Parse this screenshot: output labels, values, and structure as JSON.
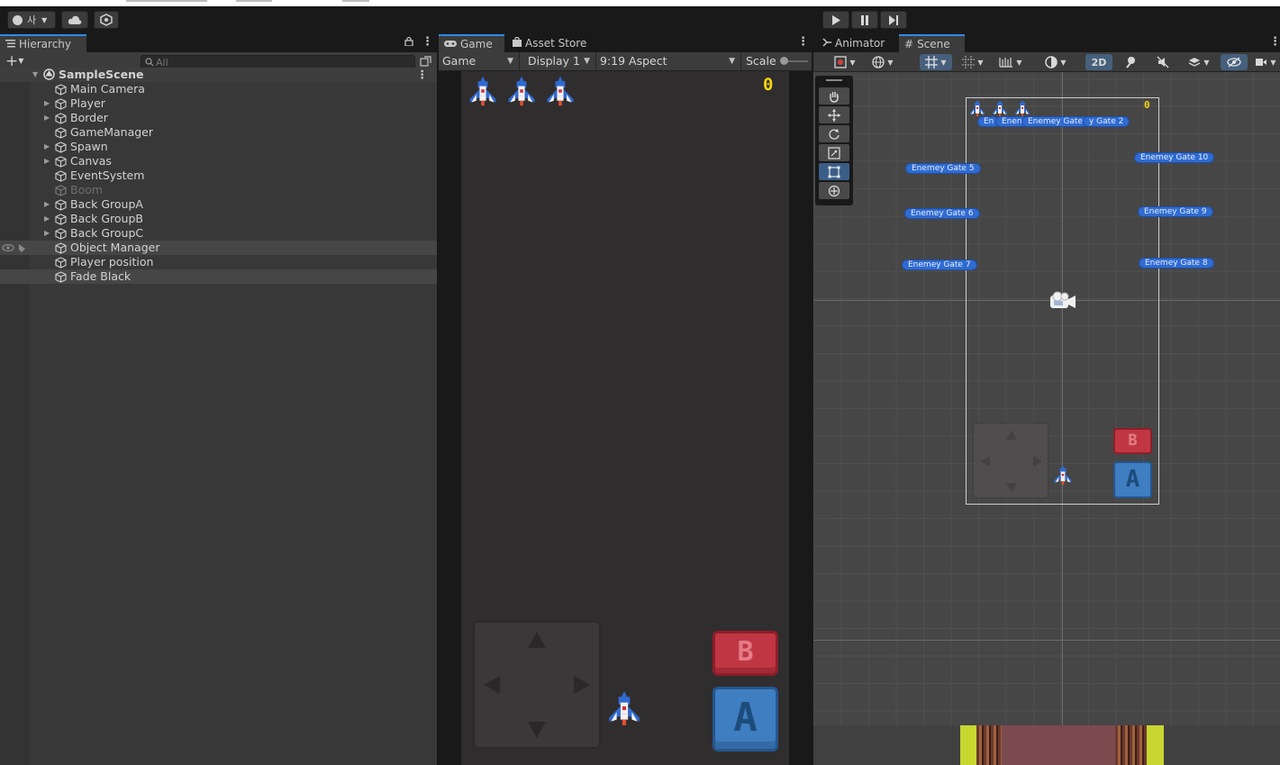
{
  "toolbar": {
    "account_label": "사",
    "play_icon": "play-icon",
    "pause_icon": "pause-icon",
    "step_icon": "step-icon"
  },
  "hierarchy": {
    "tab_label": "Hierarchy",
    "add_label": "+",
    "search_placeholder": "All",
    "scene_name": "SampleScene",
    "items": [
      {
        "label": "Main Camera",
        "expandable": false,
        "disabled": false,
        "highlight": false
      },
      {
        "label": "Player",
        "expandable": true,
        "disabled": false,
        "highlight": false
      },
      {
        "label": "Border",
        "expandable": true,
        "disabled": false,
        "highlight": false
      },
      {
        "label": "GameManager",
        "expandable": false,
        "disabled": false,
        "highlight": false
      },
      {
        "label": "Spawn",
        "expandable": true,
        "disabled": false,
        "highlight": false
      },
      {
        "label": "Canvas",
        "expandable": true,
        "disabled": false,
        "highlight": false
      },
      {
        "label": "EventSystem",
        "expandable": false,
        "disabled": false,
        "highlight": false
      },
      {
        "label": "Boom",
        "expandable": false,
        "disabled": true,
        "highlight": false
      },
      {
        "label": "Back GroupA",
        "expandable": true,
        "disabled": false,
        "highlight": false
      },
      {
        "label": "Back GroupB",
        "expandable": true,
        "disabled": false,
        "highlight": false
      },
      {
        "label": "Back GroupC",
        "expandable": true,
        "disabled": false,
        "highlight": false
      },
      {
        "label": "Object Manager",
        "expandable": false,
        "disabled": false,
        "highlight": true
      },
      {
        "label": "Player position",
        "expandable": false,
        "disabled": false,
        "highlight": false
      },
      {
        "label": "Fade Black",
        "expandable": false,
        "disabled": false,
        "highlight": true
      }
    ]
  },
  "game": {
    "tab_label": "Game",
    "store_tab_label": "Asset Store",
    "mode_select": "Game",
    "display_select": "Display 1",
    "aspect_select": "9:19 Aspect",
    "scale_label": "Scale",
    "score": "0",
    "button_b": "B",
    "button_a": "A",
    "lives": 3
  },
  "scene": {
    "animator_tab_label": "Animator",
    "scene_tab_label": "Scene",
    "mode_2d": "2D",
    "score": "0",
    "gates": [
      {
        "label": "En"
      },
      {
        "label": "Enen"
      },
      {
        "label": "Enemey Gate 1"
      },
      {
        "label": "y Gate 2"
      },
      {
        "label": "Enemey Gate 5"
      },
      {
        "label": "Enemey Gate 10"
      },
      {
        "label": "Enemey Gate 6"
      },
      {
        "label": "Enemey Gate 9"
      },
      {
        "label": "Enemey Gate 7"
      },
      {
        "label": "Enemey Gate 8"
      }
    ],
    "button_b": "B",
    "button_a": "A"
  },
  "colors": {
    "accent": "#2f8ae8",
    "score_yellow": "#f4d70a",
    "gate_blue": "#2f6bd1",
    "button_red": "#c03743",
    "button_blue": "#3f7ec0"
  }
}
